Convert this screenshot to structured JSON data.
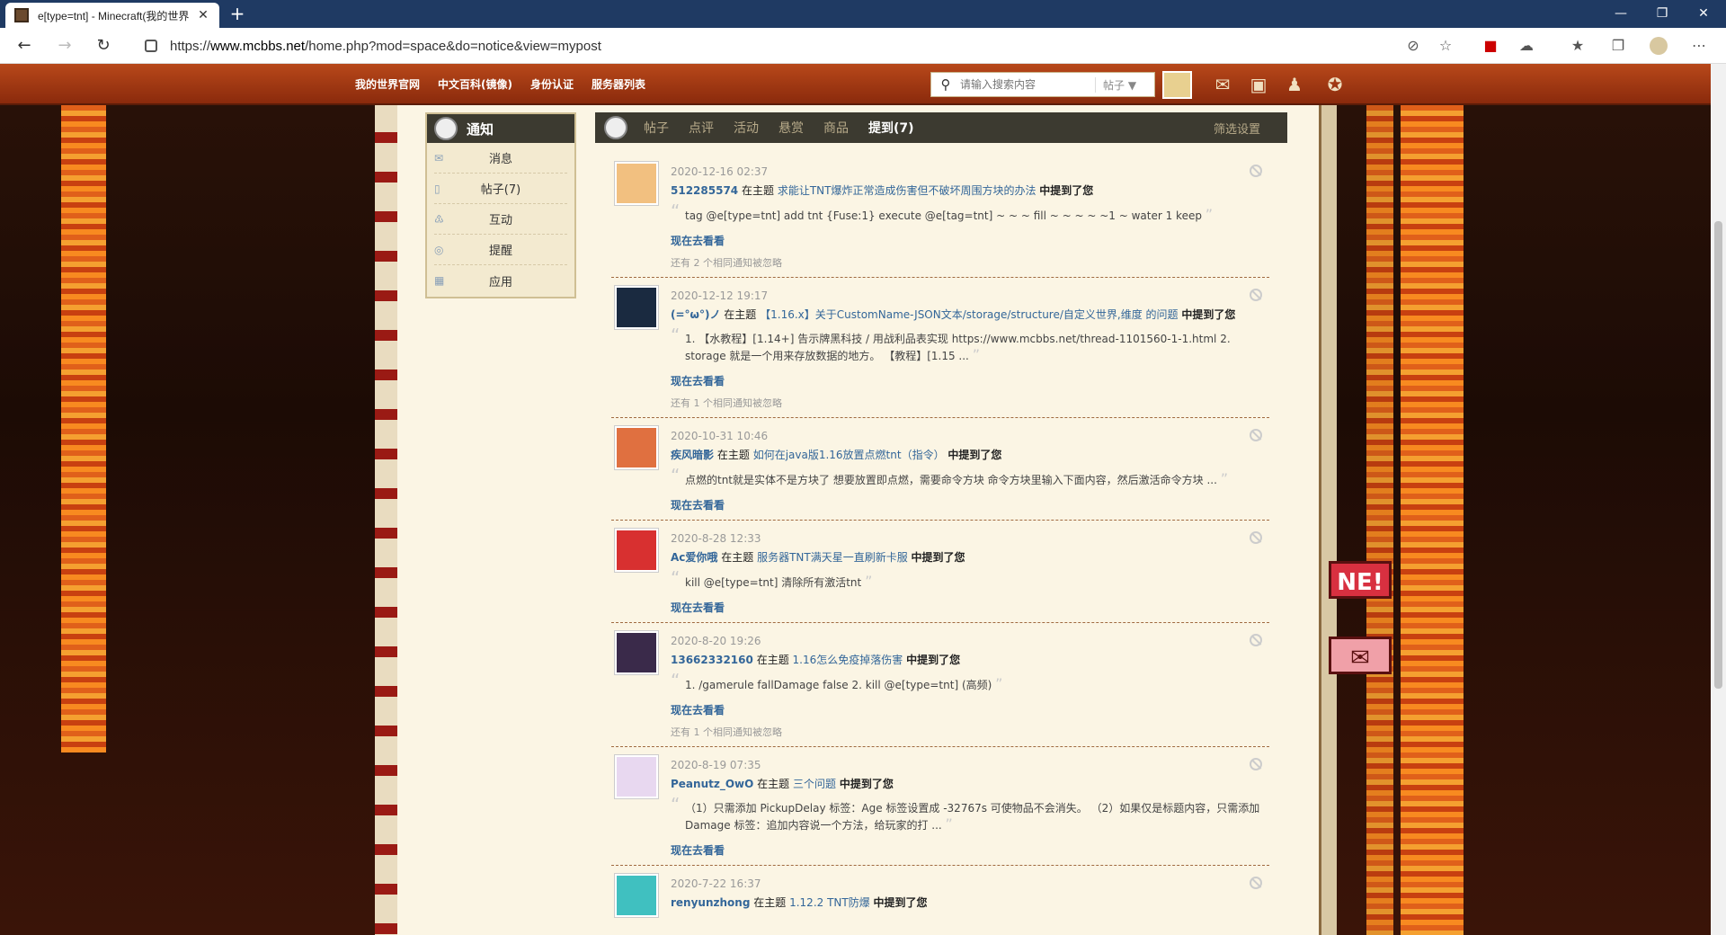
{
  "browser": {
    "tab_title": "e[type=tnt] - Minecraft(我的世界",
    "new_tab": "+",
    "url_prefix": "https://",
    "url_host": "www.mcbbs.net",
    "url_path": "/home.php?mod=space&do=notice&view=mypost",
    "minimize": "—",
    "maximize": "❐",
    "close": "✕"
  },
  "header": {
    "nav": [
      "我的世界官网",
      "中文百科(镜像)",
      "身份认证",
      "服务器列表"
    ],
    "search_placeholder": "请输入搜索内容",
    "search_type": "帖子 ▼"
  },
  "sidebar": {
    "title": "通知",
    "items": [
      {
        "label": "消息",
        "icon": "✉"
      },
      {
        "label": "帖子(7)",
        "icon": "▯"
      },
      {
        "label": "互动",
        "icon": "♳"
      },
      {
        "label": "提醒",
        "icon": "◎"
      },
      {
        "label": "应用",
        "icon": "▦"
      }
    ]
  },
  "tabs": {
    "items": [
      "帖子",
      "点评",
      "活动",
      "悬赏",
      "商品"
    ],
    "active": "提到(7)",
    "filter": "筛选设置"
  },
  "notices": [
    {
      "time": "2020-12-16 02:37",
      "user": "512285574",
      "mid": "在主题",
      "topic": "求能让TNT爆炸正常造成伤害但不破坏周围方块的办法",
      "tail": "中提到了您",
      "quote": "tag @e[type=tnt] add tnt {Fuse:1} execute @e[tag=tnt] ~ ~ ~ fill ~ ~ ~ ~ ~1 ~ water 1 keep",
      "go": "现在去看看",
      "ignored": "还有 2 个相同通知被忽略",
      "avatar_color": "#f2c080"
    },
    {
      "time": "2020-12-12 19:17",
      "user": "(=°ω°)ノ",
      "mid": "在主题",
      "topic": "【1.16.x】关于CustomName-JSON文本/storage/structure/自定义世界,维度 的问题",
      "tail": "中提到了您",
      "quote": "1. 【水教程】[1.14+] 告示牌黑科技 / 用战利品表实现 https://www.mcbbs.net/thread-1101560-1-1.html 2. storage 就是一个用来存放数据的地方。 【教程】[1.15 ...",
      "go": "现在去看看",
      "ignored": "还有 1 个相同通知被忽略",
      "avatar_color": "#1a2a40"
    },
    {
      "time": "2020-10-31 10:46",
      "user": "疾风暗影",
      "mid": "在主题",
      "topic": "如何在java版1.16放置点燃tnt（指令）",
      "tail": "中提到了您",
      "quote": "点燃的tnt就是实体不是方块了 想要放置即点燃，需要命令方块 命令方块里输入下面内容，然后激活命令方块 ...",
      "go": "现在去看看",
      "ignored": "",
      "avatar_color": "#e07040"
    },
    {
      "time": "2020-8-28 12:33",
      "user": "Ac爱你哦",
      "mid": "在主题",
      "topic": "服务器TNT满天星一直刷新卡服",
      "tail": "中提到了您",
      "quote": "kill @e[type=tnt] 清除所有激活tnt",
      "go": "现在去看看",
      "ignored": "",
      "avatar_color": "#d83030"
    },
    {
      "time": "2020-8-20 19:26",
      "user": "13662332160",
      "mid": "在主题",
      "topic": "1.16怎么免疫掉落伤害",
      "tail": "中提到了您",
      "quote": "1. /gamerule fallDamage false 2. kill @e[type=tnt] (高频)",
      "go": "现在去看看",
      "ignored": "还有 1 个相同通知被忽略",
      "avatar_color": "#3a2a4a"
    },
    {
      "time": "2020-8-19 07:35",
      "user": "Peanutz_OwO",
      "mid": "在主题",
      "topic": "三个问题",
      "tail": "中提到了您",
      "quote": "（1）只需添加 PickupDelay 标签：Age 标签设置成 -32767s 可使物品不会消失。 （2）如果仅是标题内容，只需添加 Damage 标签：追加内容说一个方法，给玩家的打 ...",
      "go": "现在去看看",
      "ignored": "",
      "avatar_color": "#e8d8f0"
    },
    {
      "time": "2020-7-22 16:37",
      "user": "renyunzhong",
      "mid": "在主题",
      "topic": "1.12.2 TNT防爆",
      "tail": "中提到了您",
      "quote": "",
      "go": "",
      "ignored": "",
      "avatar_color": "#40c0c0"
    }
  ],
  "flags": {
    "new": "NE!",
    "mail": "✉"
  }
}
